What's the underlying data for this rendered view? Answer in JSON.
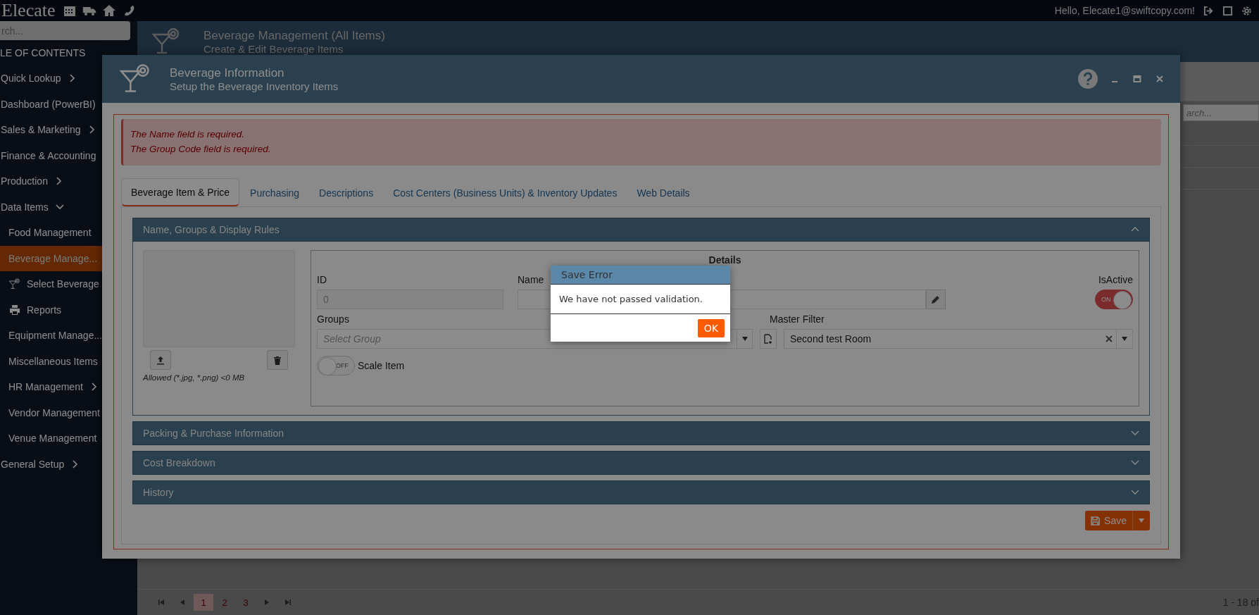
{
  "header": {
    "logo": "Elecate",
    "greeting": "Hello, Elecate1@swiftcopy.com!"
  },
  "sidebar": {
    "search": {
      "placeholder": "rch..."
    },
    "heading": "LE OF CONTENTS",
    "items": [
      {
        "label": "Quick Lookup",
        "expanded": false
      },
      {
        "label": "Dashboard (PowerBI)"
      },
      {
        "label": "Sales & Marketing",
        "expanded": false
      },
      {
        "label": "Finance & Accounting"
      },
      {
        "label": "Production",
        "expanded": false
      },
      {
        "label": "Data Items",
        "expanded": true,
        "children": [
          {
            "label": "Food Management",
            "selected": false
          },
          {
            "label": "Beverage Manage...",
            "selected": true
          },
          {
            "label": "Select Beverage",
            "selected": false
          },
          {
            "label": "Reports",
            "selected": false
          },
          {
            "label": "Equipment Manage...",
            "selected": false
          },
          {
            "label": "Miscellaneous Items",
            "selected": false
          },
          {
            "label": "HR Management",
            "selected": false,
            "expanded": false
          },
          {
            "label": "Vendor Management",
            "selected": false
          },
          {
            "label": "Venue Management",
            "selected": false
          }
        ]
      },
      {
        "label": "General Setup",
        "expanded": false
      }
    ]
  },
  "page": {
    "title": "Beverage Management (All Items)",
    "subtitle": "Create & Edit Beverage Items",
    "search": {
      "placeholder": "arch..."
    },
    "pager": {
      "pages": [
        {
          "label": "1",
          "selected": true
        },
        {
          "label": "2",
          "selected": false
        },
        {
          "label": "3",
          "selected": false
        }
      ],
      "summary": "1 - 18 of"
    }
  },
  "modal": {
    "title": "Beverage Information",
    "subtitle": "Setup the Beverage Inventory Items",
    "errors": [
      "The Name field is required.",
      "The Group Code field is required."
    ],
    "tabs": [
      {
        "label": "Beverage Item & Price",
        "selected": true
      },
      {
        "label": "Purchasing",
        "selected": false
      },
      {
        "label": "Descriptions",
        "selected": false
      },
      {
        "label": "Cost Centers (Business Units) & Inventory Updates",
        "selected": false
      },
      {
        "label": "Web Details",
        "selected": false
      }
    ],
    "sections": [
      {
        "title": "Name, Groups & Display Rules",
        "expanded": true
      },
      {
        "title": "Packing & Purchase Information",
        "expanded": false
      },
      {
        "title": "Cost Breakdown",
        "expanded": false
      },
      {
        "title": "History",
        "expanded": false
      }
    ],
    "image_hint": "Allowed (*.jpg, *.png) <0 MB",
    "details": {
      "title": "Details",
      "id": {
        "label": "ID",
        "value": "0",
        "disabled": true
      },
      "name": {
        "label": "Name"
      },
      "is_active": {
        "label": "IsActive",
        "on": true,
        "text": "ON"
      },
      "groups": {
        "label": "Groups",
        "placeholder": "Select Group"
      },
      "master_filter": {
        "label": "Master Filter",
        "value": "Second test Room"
      },
      "scale_item": {
        "label": "Scale Item",
        "on": false,
        "text": "OFF"
      }
    },
    "save": "Save"
  },
  "dialog": {
    "title": "Save Error",
    "message": "We have not passed validation.",
    "button": "OK"
  }
}
